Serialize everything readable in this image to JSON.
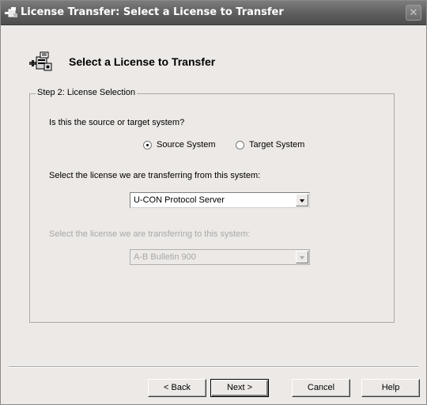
{
  "window": {
    "title": "License Transfer: Select a License to Transfer",
    "close_glyph": "✕"
  },
  "header": {
    "title": "Select a License to Transfer",
    "icon": "license-transfer-icon"
  },
  "group": {
    "legend": "Step 2: License Selection",
    "system_question": "Is this the source or target system?",
    "system_options": [
      {
        "label": "Source System",
        "checked": true
      },
      {
        "label": "Target System",
        "checked": false
      }
    ],
    "from_label": "Select the license we are transferring from this system:",
    "from_selected": "U-CON Protocol Server",
    "to_label": "Select the license we are transferring to this system:",
    "to_selected": "A-B Bulletin 900"
  },
  "buttons": {
    "back": "< Back",
    "next": "Next >",
    "cancel": "Cancel",
    "help": "Help"
  }
}
